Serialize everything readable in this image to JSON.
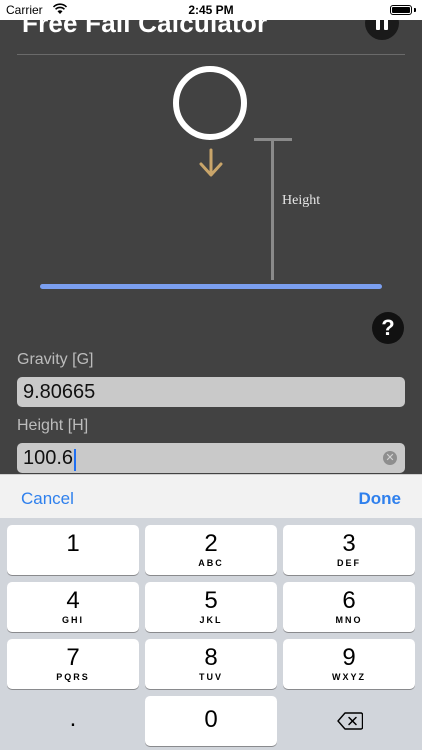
{
  "status_bar": {
    "carrier": "Carrier",
    "time": "2:45 PM"
  },
  "header": {
    "title": "Free Fall Calculator"
  },
  "diagram": {
    "height_label": "Height"
  },
  "form": {
    "gravity": {
      "label": "Gravity [G]",
      "value": "9.80665"
    },
    "height": {
      "label": "Height [H]",
      "value": "100.6"
    }
  },
  "keyboard": {
    "toolbar": {
      "cancel": "Cancel",
      "done": "Done"
    },
    "keys": [
      {
        "num": "1",
        "letters": ""
      },
      {
        "num": "2",
        "letters": "ABC"
      },
      {
        "num": "3",
        "letters": "DEF"
      },
      {
        "num": "4",
        "letters": "GHI"
      },
      {
        "num": "5",
        "letters": "JKL"
      },
      {
        "num": "6",
        "letters": "MNO"
      },
      {
        "num": "7",
        "letters": "PQRS"
      },
      {
        "num": "8",
        "letters": "TUV"
      },
      {
        "num": "9",
        "letters": "WXYZ"
      }
    ],
    "decimal": ".",
    "zero": "0"
  },
  "colors": {
    "accent": "#2f80ed",
    "ground": "#7b9ff0",
    "arrow": "#c9a56a",
    "background": "#424242"
  },
  "icons": [
    "wifi-icon",
    "battery-icon",
    "pause-icon",
    "down-arrow-icon",
    "help-icon",
    "clear-icon",
    "backspace-icon"
  ]
}
